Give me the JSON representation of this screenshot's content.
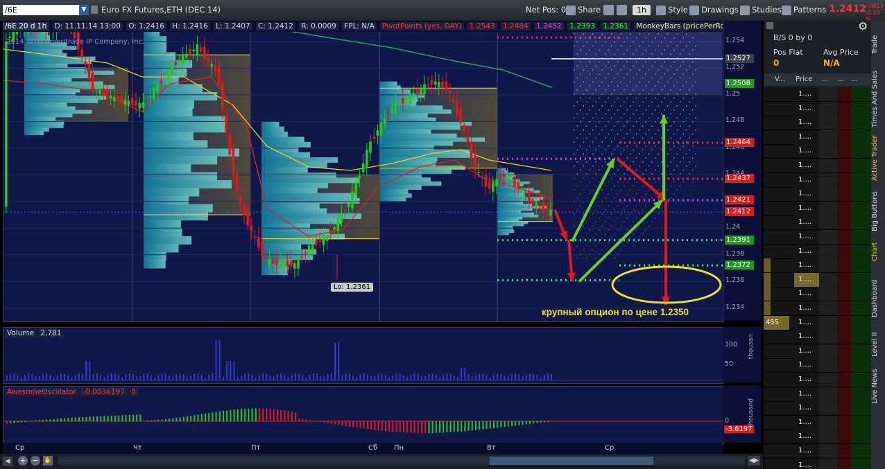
{
  "toolbar": {
    "symbol": "/6E",
    "description": "Euro FX Futures,ETH (DEC 14)",
    "net_pos": "Net Pos: 0",
    "share": "Share",
    "timeframe": "1h",
    "style": "Style",
    "drawings": "Drawings",
    "studies": "Studies",
    "patterns": "Patterns",
    "last_price": "1.2412",
    "change_abs": "-.0013",
    "change_pct": "-0.10 %"
  },
  "info_bar": {
    "chart_label": "/6E 20 d 1h",
    "date": "D: 11.11.14 13:00",
    "open": "O: 1.2416",
    "high": "H: 1.2416",
    "low": "L: 1.2407",
    "close": "C: 1.2412",
    "range": "R: 0.0009",
    "fpl": "FPL: N/A",
    "pivot_label": "PivotPoints (yes, DAY)",
    "pivot_values": [
      "1.2543",
      "1.2484",
      "1.2452",
      "1.2393",
      "1.2361"
    ],
    "monkey": "MonkeyBars (pricePerRowHeightMode:..."
  },
  "copyright": "2014 ©TD Ameritrade IP Company, Inc.",
  "price_axis": {
    "ticks": [
      "1.254",
      "1.252",
      "1.25",
      "1.248",
      "1.246",
      "1.244",
      "1.242",
      "1.24",
      "1.238",
      "1.236",
      "1.234"
    ],
    "tags": [
      {
        "value": "1.2527",
        "color": "#ffffff",
        "bg": "#3a3f4a"
      },
      {
        "value": "1.2508",
        "color": "#ffffff",
        "bg": "#1f9c1f"
      },
      {
        "value": "1.2464",
        "color": "#ffffff",
        "bg": "#d41f1f"
      },
      {
        "value": "1.2437",
        "color": "#ffffff",
        "bg": "#d41f1f"
      },
      {
        "value": "1.2421",
        "color": "#ffffff",
        "bg": "#d41f1f"
      },
      {
        "value": "1.2412",
        "color": "#ffffff",
        "bg": "#d41f1f"
      },
      {
        "value": "1.2391",
        "color": "#ffffff",
        "bg": "#1f9c1f"
      },
      {
        "value": "1.2372",
        "color": "#ffffff",
        "bg": "#1f9c1f"
      }
    ]
  },
  "low_label": "Lo: 1.2361",
  "annotation": "крупный опцион по цене 1.2350",
  "volume": {
    "label": "Volume",
    "value": "2,781",
    "ticks": [
      "100",
      "50"
    ],
    "unit": "thousan"
  },
  "ao": {
    "label": "AwesomeOscillator",
    "value": "-0.0036197",
    "zero": "0",
    "tick": "0",
    "last": "-3.6197",
    "unit": "thousand"
  },
  "time_axis": [
    "Ср",
    "Чт",
    "Пт",
    "Сб",
    "Пн",
    "Вт",
    "Ср"
  ],
  "right_panel": {
    "bs": "B/S 0 by 0",
    "pos_label": "Pos Flat",
    "pos_value": "0",
    "avg_label": "Avg Price",
    "avg_value": "N/A",
    "col_v": "V...",
    "col_price": "Price",
    "dots": "...",
    "ladder_price": "1....",
    "volume_cell": "455"
  },
  "side_tabs": [
    "Trade",
    "Times And Sales",
    "Active Trader",
    "Big Buttons",
    "Chart",
    "Dashboard",
    "Level II",
    "Live News"
  ],
  "colors": {
    "bg": "#10174a",
    "up": "#22c722",
    "down": "#e01818",
    "pivot_red": "#ff2a2a",
    "pivot_green": "#2aff2a",
    "magenta": "#e040e0",
    "yellow": "#f0e020"
  }
}
